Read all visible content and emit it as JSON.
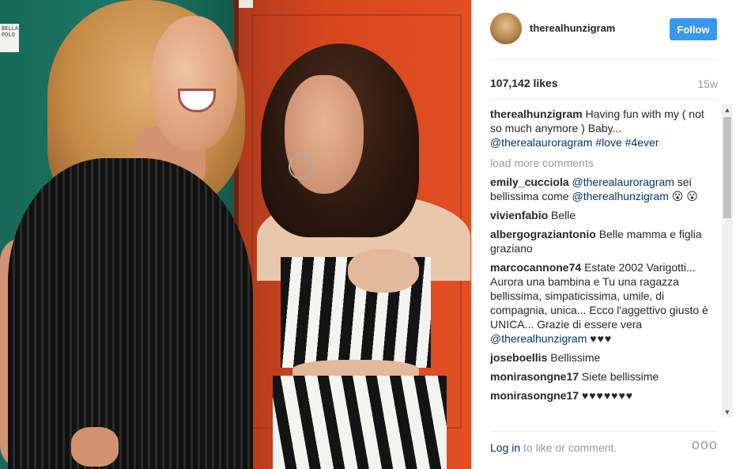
{
  "post": {
    "username": "therealhunzigram",
    "follow_label": "Follow",
    "likes": "107,142 likes",
    "time_ago": "15w",
    "caption": {
      "user": "therealhunzigram",
      "text": "Having fun with my ( not so much anymore ) Baby...",
      "mention": "@therealauroragram",
      "tags": "#love #4ever"
    },
    "load_more": "load more comments",
    "comments": [
      {
        "user": "emily_cucciola",
        "pre": "",
        "mention": "@therealauroragram",
        "mid": " sei bellissima come ",
        "mention2": "@therealhunzigram",
        "post": " 😮 😮"
      },
      {
        "user": "vivienfabio",
        "text": "Belle"
      },
      {
        "user": "albergograziantonio",
        "text": "Belle mamma e figlia graziano"
      },
      {
        "user": "marcocannone74",
        "text": "Estate 2002 Varigotti... Aurora una bambina e Tu una ragazza bellissima, simpaticissima, umile, di compagnia, unica... Ecco l'aggettivo giusto è UNICA... Grazie di essere vera",
        "mention": "@therealhunzigram",
        "hearts": "♥♥♥"
      },
      {
        "user": "joseboellis",
        "text": "Bellissime"
      },
      {
        "user": "monirasongne17",
        "text": "Siete bellissime"
      },
      {
        "user": "monirasongne17",
        "text": "♥♥♥♥♥♥♥"
      }
    ],
    "footer": {
      "login": "Log in",
      "rest": "to like or comment.",
      "more": "ooo"
    },
    "photo_note": "BELLA POLO",
    "icons": {
      "avatar": "avatar-image",
      "more": "more-options-icon",
      "scroll_up": "scroll-up-arrow-icon",
      "scroll_down": "scroll-down-arrow-icon"
    },
    "colors": {
      "follow_button": "#3897f0",
      "link": "#003569",
      "muted": "#999999"
    }
  }
}
